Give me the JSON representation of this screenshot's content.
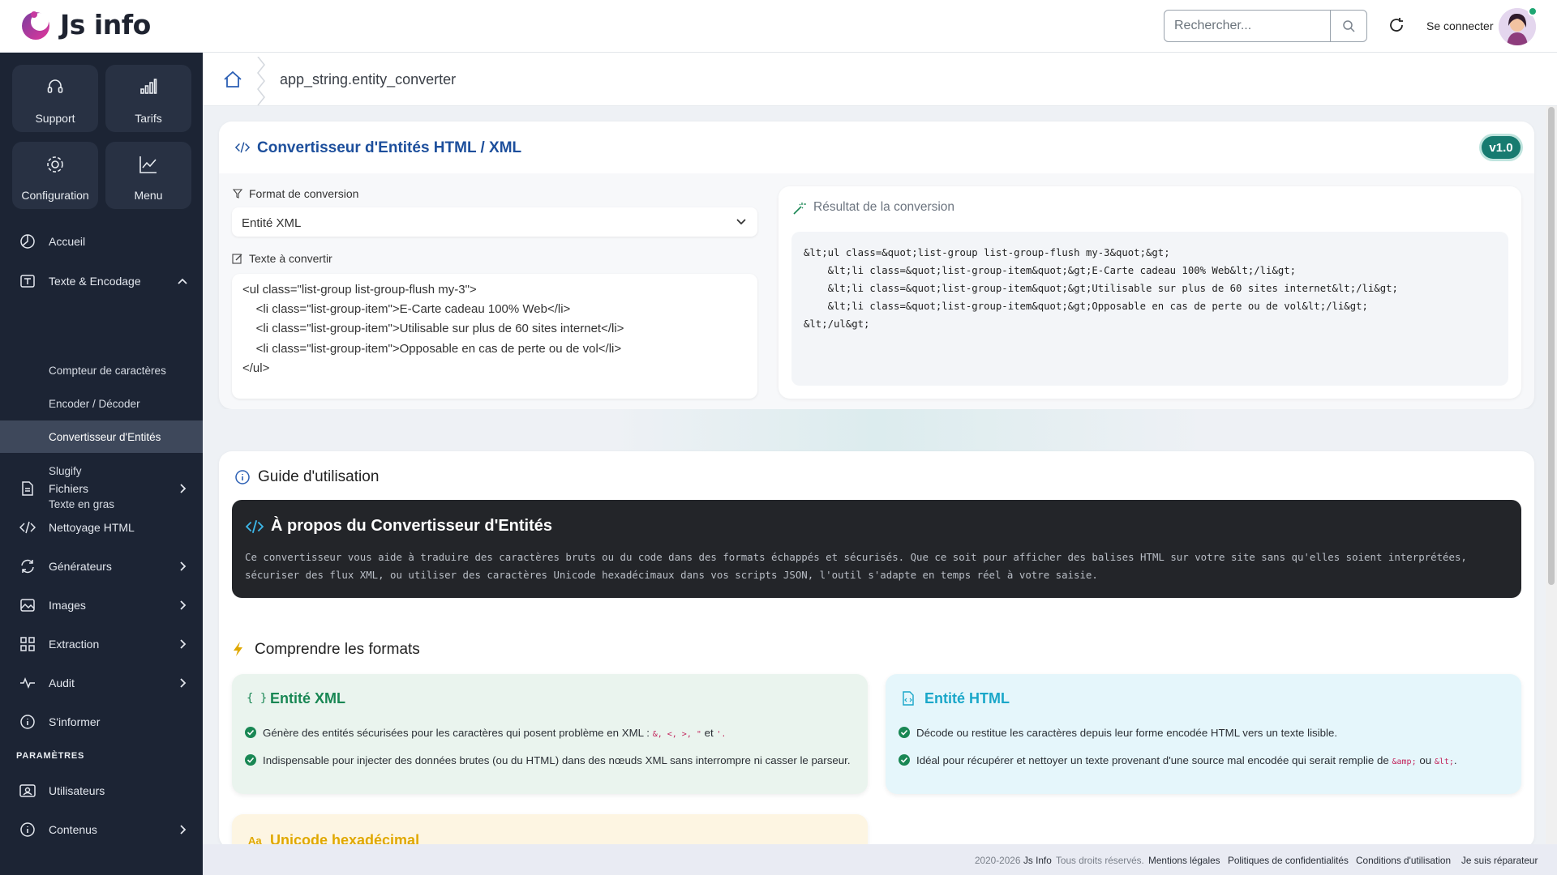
{
  "app": {
    "title": "Js info"
  },
  "header": {
    "search_placeholder": "Rechercher...",
    "login_label": "Se connecter"
  },
  "sidebar": {
    "tiles": [
      {
        "label": "Support",
        "icon": "headset-icon"
      },
      {
        "label": "Tarifs",
        "icon": "bar-chart-icon"
      },
      {
        "label": "Configuration",
        "icon": "gear-icon"
      },
      {
        "label": "Menu",
        "icon": "trend-chart-icon"
      }
    ],
    "items": [
      {
        "label": "Accueil",
        "icon": "pie-chart-icon"
      },
      {
        "label": "Texte & Encodage",
        "icon": "text-icon",
        "expanded": true
      },
      {
        "label": "Fichiers",
        "icon": "file-icon"
      },
      {
        "label": "Nettoyage HTML",
        "icon": "code-icon"
      },
      {
        "label": "Générateurs",
        "icon": "cycle-icon"
      },
      {
        "label": "Images",
        "icon": "image-icon"
      },
      {
        "label": "Extraction",
        "icon": "grid-icon"
      },
      {
        "label": "Audit",
        "icon": "pulse-icon"
      },
      {
        "label": "S'informer",
        "icon": "info-icon"
      }
    ],
    "subitems": [
      {
        "label": "Compteur de caractères"
      },
      {
        "label": "Encoder / Décoder"
      },
      {
        "label": "Convertisseur d'Entités",
        "active": true
      },
      {
        "label": "Slugify"
      },
      {
        "label": "Texte en gras"
      }
    ],
    "settings_title": "PARAMÈTRES",
    "settings_items": [
      {
        "label": "Utilisateurs",
        "icon": "user-card-icon"
      },
      {
        "label": "Contenus",
        "icon": "info-icon"
      }
    ]
  },
  "breadcrumb": {
    "path": "app_string.entity_converter"
  },
  "converter": {
    "title": "Convertisseur d'Entités HTML / XML",
    "version": "v1.0",
    "format_label": "Format de conversion",
    "format_value": "Entité XML",
    "input_label": "Texte à convertir",
    "input_value": "<ul class=\"list-group list-group-flush my-3\">\n    <li class=\"list-group-item\">E-Carte cadeau 100% Web</li>\n    <li class=\"list-group-item\">Utilisable sur plus de 60 sites internet</li>\n    <li class=\"list-group-item\">Opposable en cas de perte ou de vol</li>\n</ul>",
    "result_label": "Résultat de la conversion",
    "result_value": "&lt;ul class=&quot;list-group list-group-flush my-3&quot;&gt;\n    &lt;li class=&quot;list-group-item&quot;&gt;E-Carte cadeau 100% Web&lt;/li&gt;\n    &lt;li class=&quot;list-group-item&quot;&gt;Utilisable sur plus de 60 sites internet&lt;/li&gt;\n    &lt;li class=&quot;list-group-item&quot;&gt;Opposable en cas de perte ou de vol&lt;/li&gt;\n&lt;/ul&gt;"
  },
  "guide": {
    "title": "Guide d'utilisation",
    "about_title": "À propos du Convertisseur d'Entités",
    "about_text": "Ce convertisseur vous aide à traduire des caractères bruts ou du code dans des formats échappés et sécurisés. Que ce soit pour afficher des balises HTML sur votre site sans qu'elles soient interprétées, sécuriser des flux XML, ou utiliser des caractères Unicode hexadécimaux dans vos scripts JSON, l'outil s'adapte en temps réel à votre saisie.",
    "formats_title": "Comprendre les formats",
    "xml": {
      "title": "Entité XML",
      "b1_text": "Génère des entités sécurisées pour les caractères qui posent problème en XML :",
      "b1_codes": "&, <, >, \"",
      "b1_and": "et",
      "b1_end": "'.",
      "b2": "Indispensable pour injecter des données brutes (ou du HTML) dans des nœuds XML sans interrompre ni casser le parseur."
    },
    "html": {
      "title": "Entité HTML",
      "b1": "Décode ou restitue les caractères depuis leur forme encodée HTML vers un texte lisible.",
      "b2_text": "Idéal pour récupérer et nettoyer un texte provenant d'une source mal encodée qui serait remplie de",
      "b2_code1": "&amp;",
      "b2_or": "ou",
      "b2_code2": "&lt;",
      "b2_end": "."
    },
    "unicode": {
      "title": "Unicode hexadécimal"
    }
  },
  "footer": {
    "copyright": "2020-2026",
    "brand": "Js Info",
    "rights": "Tous droits réservés.",
    "links": [
      "Mentions légales",
      "Politiques de confidentialités",
      "Conditions d'utilisation",
      "Je suis réparateur"
    ]
  },
  "colors": {
    "sidebar_bg": "#1c2434",
    "accent_blue": "#1d4f9c",
    "badge_teal": "#177b70",
    "xml_green": "#198754",
    "html_cyan": "#1aa7c9",
    "unicode_amber": "#e0a800"
  }
}
